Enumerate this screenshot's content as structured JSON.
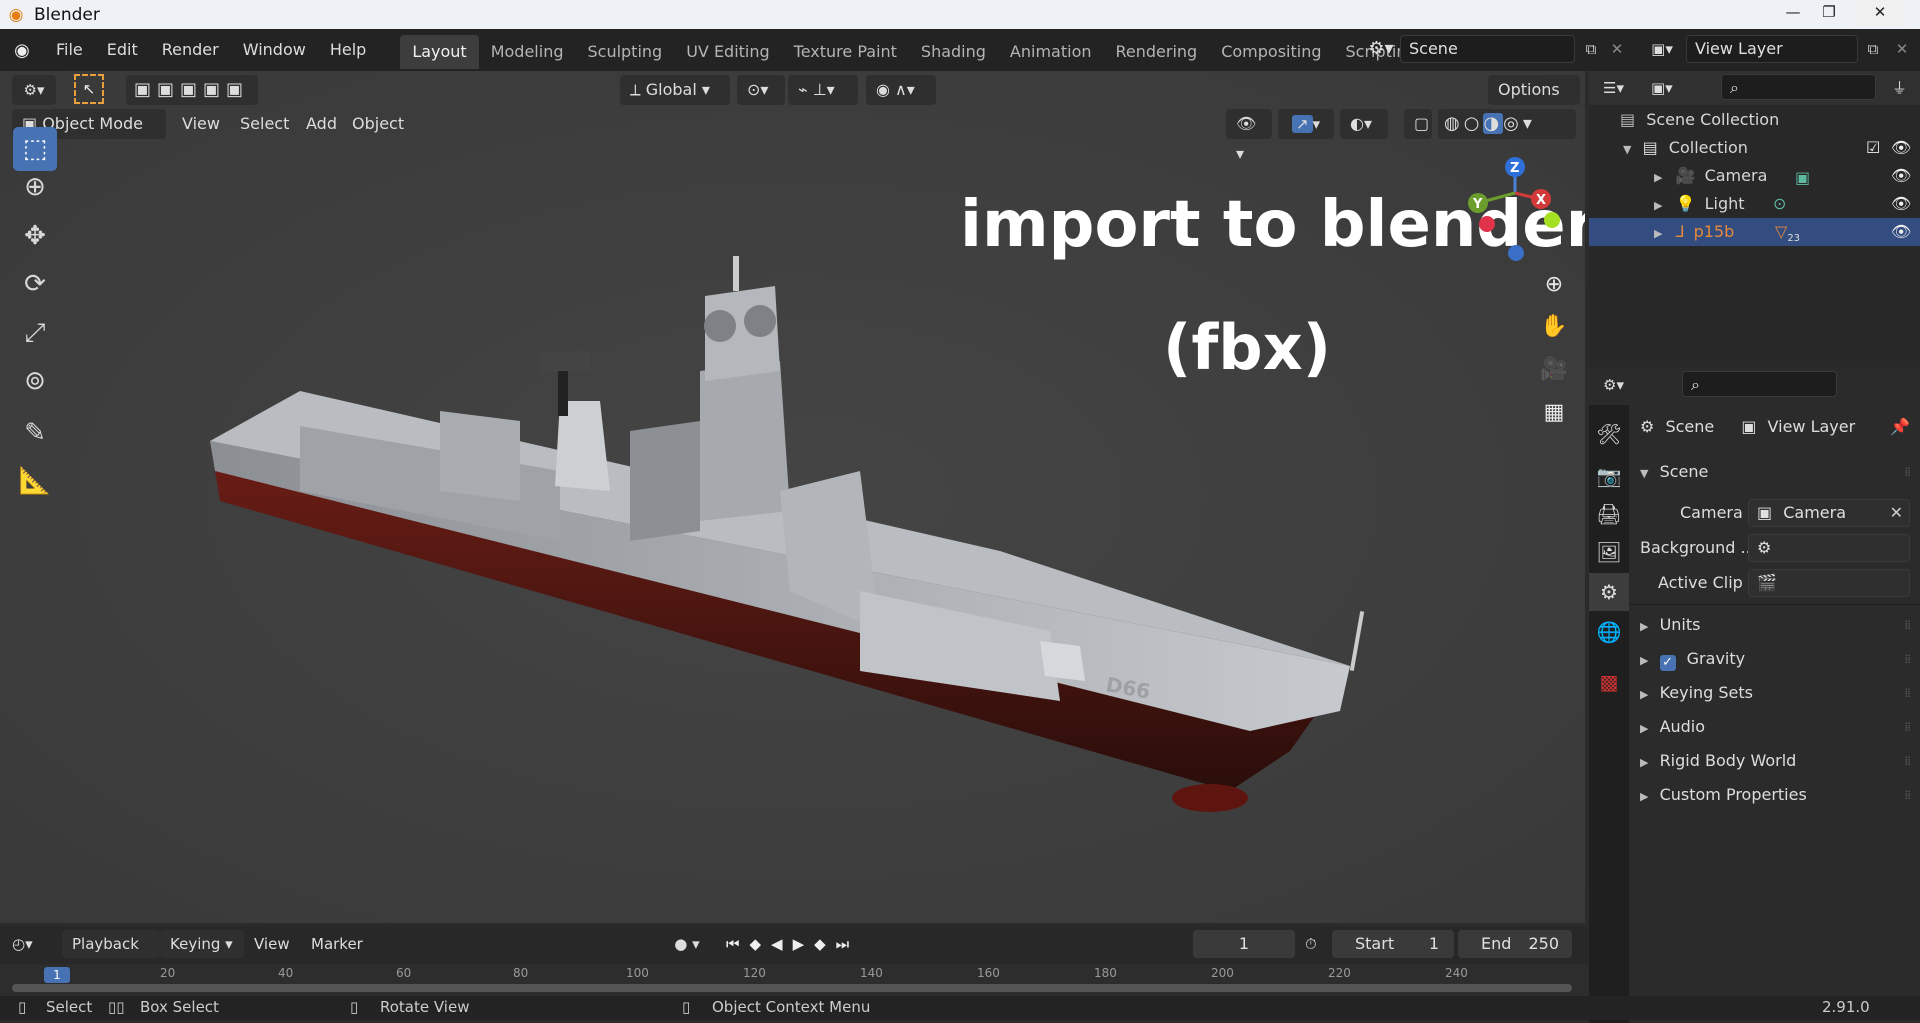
{
  "window": {
    "title": "Blender",
    "minimize": "—",
    "maximize": "❐",
    "close": "✕"
  },
  "menu": [
    "File",
    "Edit",
    "Render",
    "Window",
    "Help"
  ],
  "workspaces": [
    "Layout",
    "Modeling",
    "Sculpting",
    "UV Editing",
    "Texture Paint",
    "Shading",
    "Animation",
    "Rendering",
    "Compositing",
    "Scripting"
  ],
  "add_workspace": "+",
  "scene_field": "Scene",
  "view_layer_field": "View Layer",
  "header": {
    "transform_orientation": "Global",
    "options": "Options",
    "mode": "Object Mode",
    "view": "View",
    "select": "Select",
    "add": "Add",
    "object": "Object"
  },
  "overlay_text": {
    "line1": "import to blender",
    "line2": "(fbx)"
  },
  "hull_mark": "D66",
  "gizmo": {
    "x": "X",
    "y": "Y",
    "z": "Z"
  },
  "outliner": {
    "root": "Scene Collection",
    "collection": "Collection",
    "items": [
      {
        "label": "Camera",
        "selected": false,
        "color": "#d0d0d0"
      },
      {
        "label": "Light",
        "selected": false,
        "color": "#d0d0d0"
      },
      {
        "label": "p15b",
        "selected": true,
        "color": "#e6883a"
      }
    ],
    "p15b_badge": "23"
  },
  "properties": {
    "crumb_scene": "Scene",
    "crumb_layer": "View Layer",
    "panel_scene": "Scene",
    "camera_label": "Camera",
    "camera_value": "Camera",
    "background_label": "Background ...",
    "active_clip_label": "Active Clip",
    "panels": [
      "Units",
      "Gravity",
      "Keying Sets",
      "Audio",
      "Rigid Body World",
      "Custom Properties"
    ],
    "gravity_checked": true
  },
  "timeline": {
    "playback": "Playback",
    "keying": "Keying",
    "view": "View",
    "marker": "Marker",
    "current_frame": "1",
    "start_label": "Start",
    "start": "1",
    "end_label": "End",
    "end": "250",
    "ticks": [
      "1",
      "20",
      "40",
      "60",
      "80",
      "100",
      "120",
      "140",
      "160",
      "180",
      "200",
      "220",
      "240"
    ]
  },
  "status": {
    "select": "Select",
    "box_select": "Box Select",
    "rotate_view": "Rotate View",
    "context_menu": "Object Context Menu",
    "version": "2.91.0"
  },
  "colors": {
    "accent": "#4772b3",
    "selection_row": "#334d80",
    "object_orange": "#e6883a",
    "viewport_bg": "#3d3d3d"
  }
}
